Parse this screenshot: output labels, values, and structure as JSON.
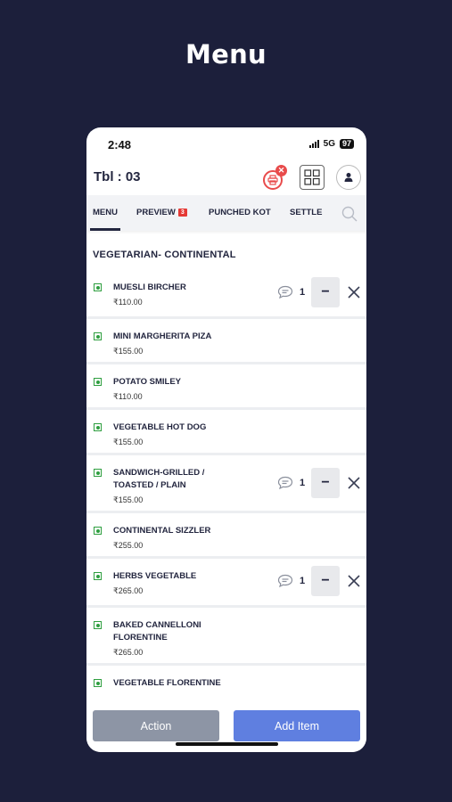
{
  "page": {
    "heading": "Menu"
  },
  "status_bar": {
    "time": "2:48",
    "network": "5G",
    "battery": "97"
  },
  "header": {
    "table_label": "Tbl : 03"
  },
  "tabs": [
    {
      "label": "MENU",
      "active": true
    },
    {
      "label": "PREVIEW",
      "badge": "3"
    },
    {
      "label": "PUNCHED KOT"
    },
    {
      "label": "SETTLE"
    }
  ],
  "section_title": "VEGETARIAN- CONTINENTAL",
  "items": [
    {
      "name": "MUESLI BIRCHER",
      "price": "₹110.00",
      "qty": "1",
      "in_cart": true
    },
    {
      "name": "MINI MARGHERITA PIZA",
      "price": "₹155.00",
      "in_cart": false
    },
    {
      "name": "POTATO SMILEY",
      "price": "₹110.00",
      "in_cart": false
    },
    {
      "name": "VEGETABLE HOT DOG",
      "price": "₹155.00",
      "in_cart": false
    },
    {
      "name": "SANDWICH-GRILLED / TOASTED / PLAIN",
      "price": "₹155.00",
      "qty": "1",
      "in_cart": true
    },
    {
      "name": "CONTINENTAL SIZZLER",
      "price": "₹255.00",
      "in_cart": false
    },
    {
      "name": "HERBS VEGETABLE",
      "price": "₹265.00",
      "qty": "1",
      "in_cart": true
    },
    {
      "name": "BAKED CANNELLONI FLORENTINE",
      "price": "₹265.00",
      "in_cart": false
    },
    {
      "name": "VEGETABLE FLORENTINE",
      "price": "",
      "in_cart": false
    }
  ],
  "buttons": {
    "action": "Action",
    "add_item": "Add Item"
  },
  "colors": {
    "background": "#1c1f3b",
    "veg_mark": "#2e9e3f",
    "alert": "#e84b4b",
    "primary": "#5f7fe0",
    "secondary": "#8d95a5"
  }
}
